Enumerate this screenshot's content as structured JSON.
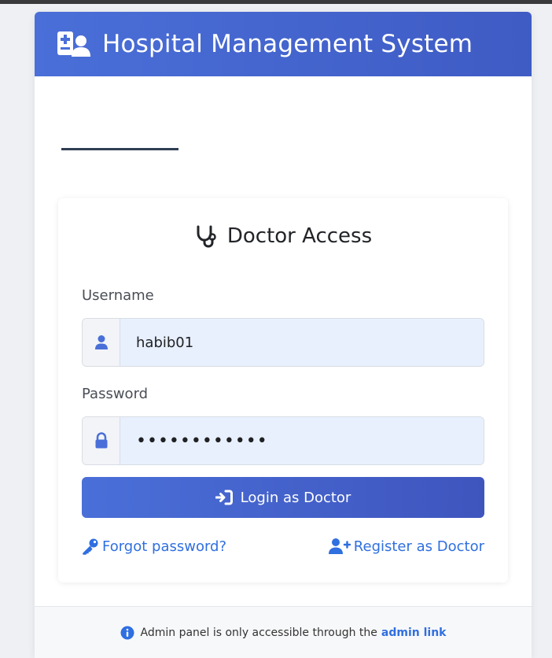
{
  "header": {
    "title": "Hospital Management System",
    "icon": "hospital-user-icon"
  },
  "login": {
    "title": "Doctor Access",
    "title_icon": "stethoscope-icon",
    "username_label": "Username",
    "username_value": "habib01",
    "username_icon": "user-icon",
    "password_label": "Password",
    "password_value": "••••••••••••",
    "password_icon": "lock-icon",
    "login_button": "Login as Doctor",
    "forgot_link": "Forgot password?",
    "register_link": "Register as Doctor"
  },
  "footer": {
    "text": "Admin panel is only accessible through the",
    "admin_link": "admin link"
  },
  "colors": {
    "primary": "#4a6fd8",
    "link": "#2f6fe0",
    "input_bg": "#e8f0fe"
  }
}
